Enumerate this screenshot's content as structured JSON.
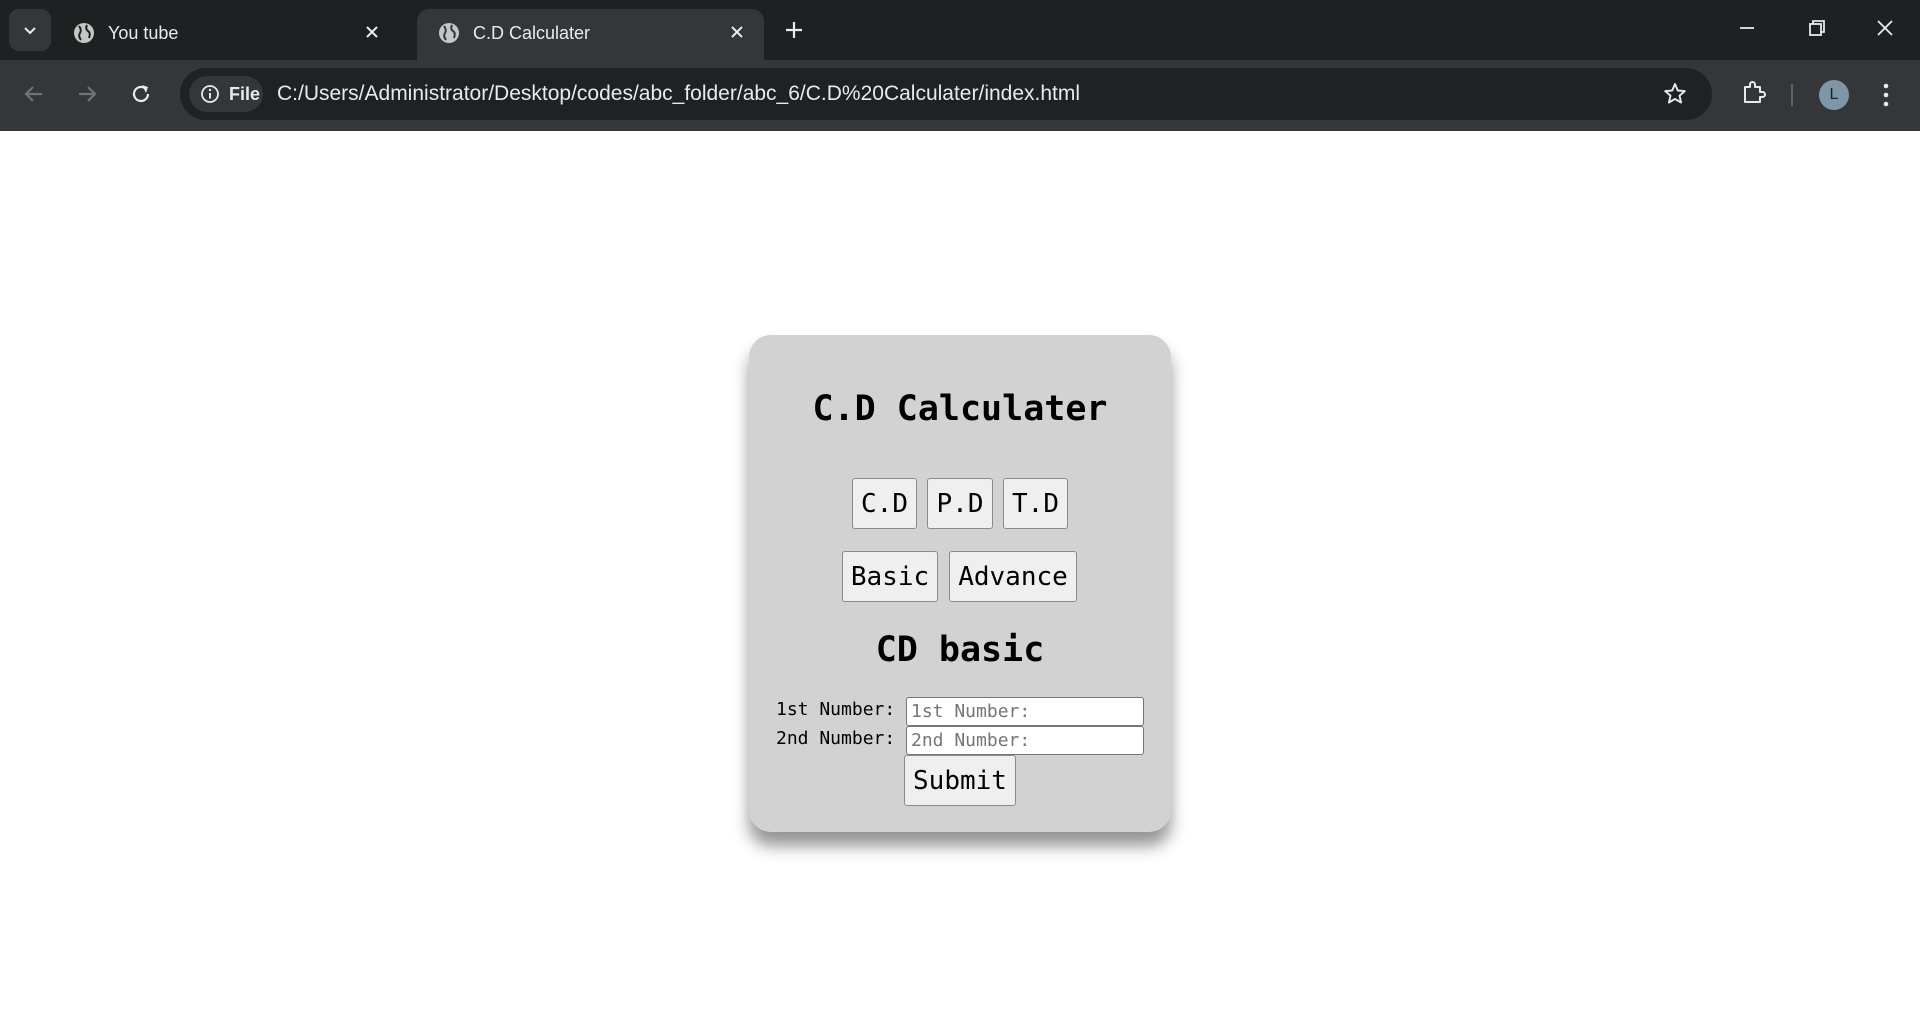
{
  "browser": {
    "tabs": [
      {
        "title": "You tube",
        "active": false
      },
      {
        "title": "C.D Calculater",
        "active": true
      }
    ],
    "address": {
      "scheme_label": "File",
      "url": "C:/Users/Administrator/Desktop/codes/abc_folder/abc_6/C.D%20Calculater/index.html"
    },
    "profile_initial": "L",
    "colors": {
      "frame": "#1f2022",
      "toolbar": "#35363a",
      "omnibox": "#202124",
      "text": "#e8eaed"
    }
  },
  "page": {
    "title": "C.D Calculater",
    "mode_buttons": [
      "C.D",
      "P.D",
      "T.D"
    ],
    "level_buttons": [
      "Basic",
      "Advance"
    ],
    "section_title": "CD basic",
    "form": {
      "first_label": "1st Number:",
      "first_placeholder": "1st Number:",
      "second_label": "2nd Number:",
      "second_placeholder": "2nd Number:",
      "submit_label": "Submit"
    },
    "colors": {
      "card": "#d3d2d2",
      "button": "#efefef"
    }
  }
}
